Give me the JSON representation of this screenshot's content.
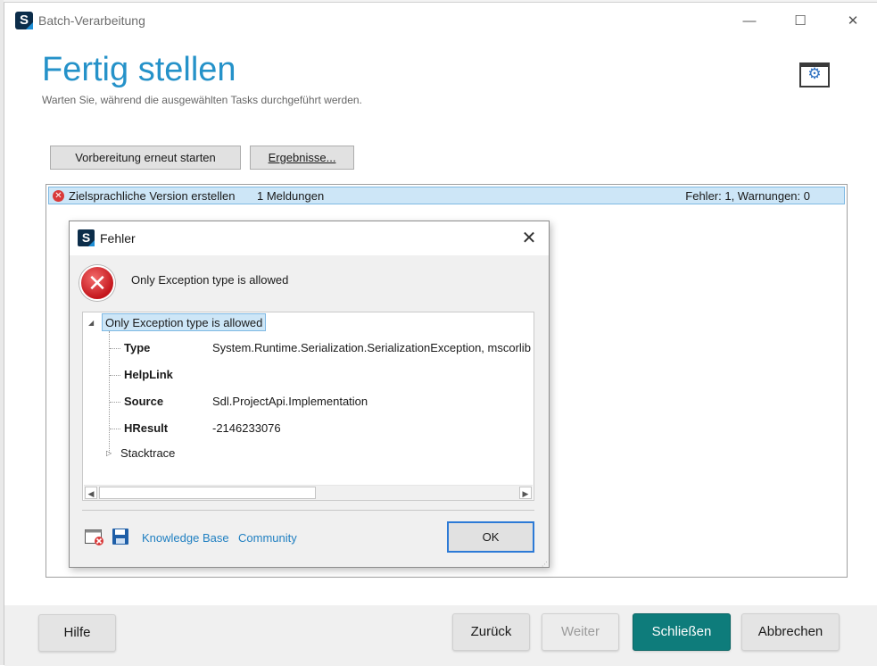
{
  "window": {
    "title": "Batch-Verarbeitung",
    "logo_letter": "S",
    "controls": {
      "minimize": "—",
      "maximize": "☐",
      "close": "✕"
    }
  },
  "page": {
    "title": "Fertig stellen",
    "subtitle": "Warten Sie, während die ausgewählten Tasks durchgeführt werden."
  },
  "toolbar": {
    "restart_label": "Vorbereitung erneut starten",
    "results_label": "Ergebnisse..."
  },
  "task": {
    "name": "Zielsprachliche Version erstellen",
    "messages": "1 Meldungen",
    "status": "Fehler: 1, Warnungen: 0"
  },
  "footer": {
    "help": "Hilfe",
    "back": "Zurück",
    "next": "Weiter",
    "close": "Schließen",
    "cancel": "Abbrechen"
  },
  "dialog": {
    "title": "Fehler",
    "logo_letter": "S",
    "message": "Only Exception type is allowed",
    "tree": {
      "root": "Only Exception type is allowed",
      "properties": [
        {
          "key": "Type",
          "value": "System.Runtime.Serialization.SerializationException, mscorlib"
        },
        {
          "key": "HelpLink",
          "value": ""
        },
        {
          "key": "Source",
          "value": "Sdl.ProjectApi.Implementation"
        },
        {
          "key": "HResult",
          "value": "-2146233076"
        }
      ],
      "stacktrace": "Stacktrace"
    },
    "links": {
      "knowledge_base": "Knowledge Base",
      "community": "Community"
    },
    "ok": "OK"
  },
  "colors": {
    "accent_title": "#2592c9",
    "primary_button": "#0e7c7b",
    "selection": "#cde6f7",
    "error": "#c4161c",
    "link": "#1f7fc1"
  },
  "icons": {
    "app": "sdl-logo-icon",
    "settings": "batch-settings-icon",
    "error": "error-icon",
    "clear_log": "clear-log-icon",
    "save": "save-icon"
  }
}
